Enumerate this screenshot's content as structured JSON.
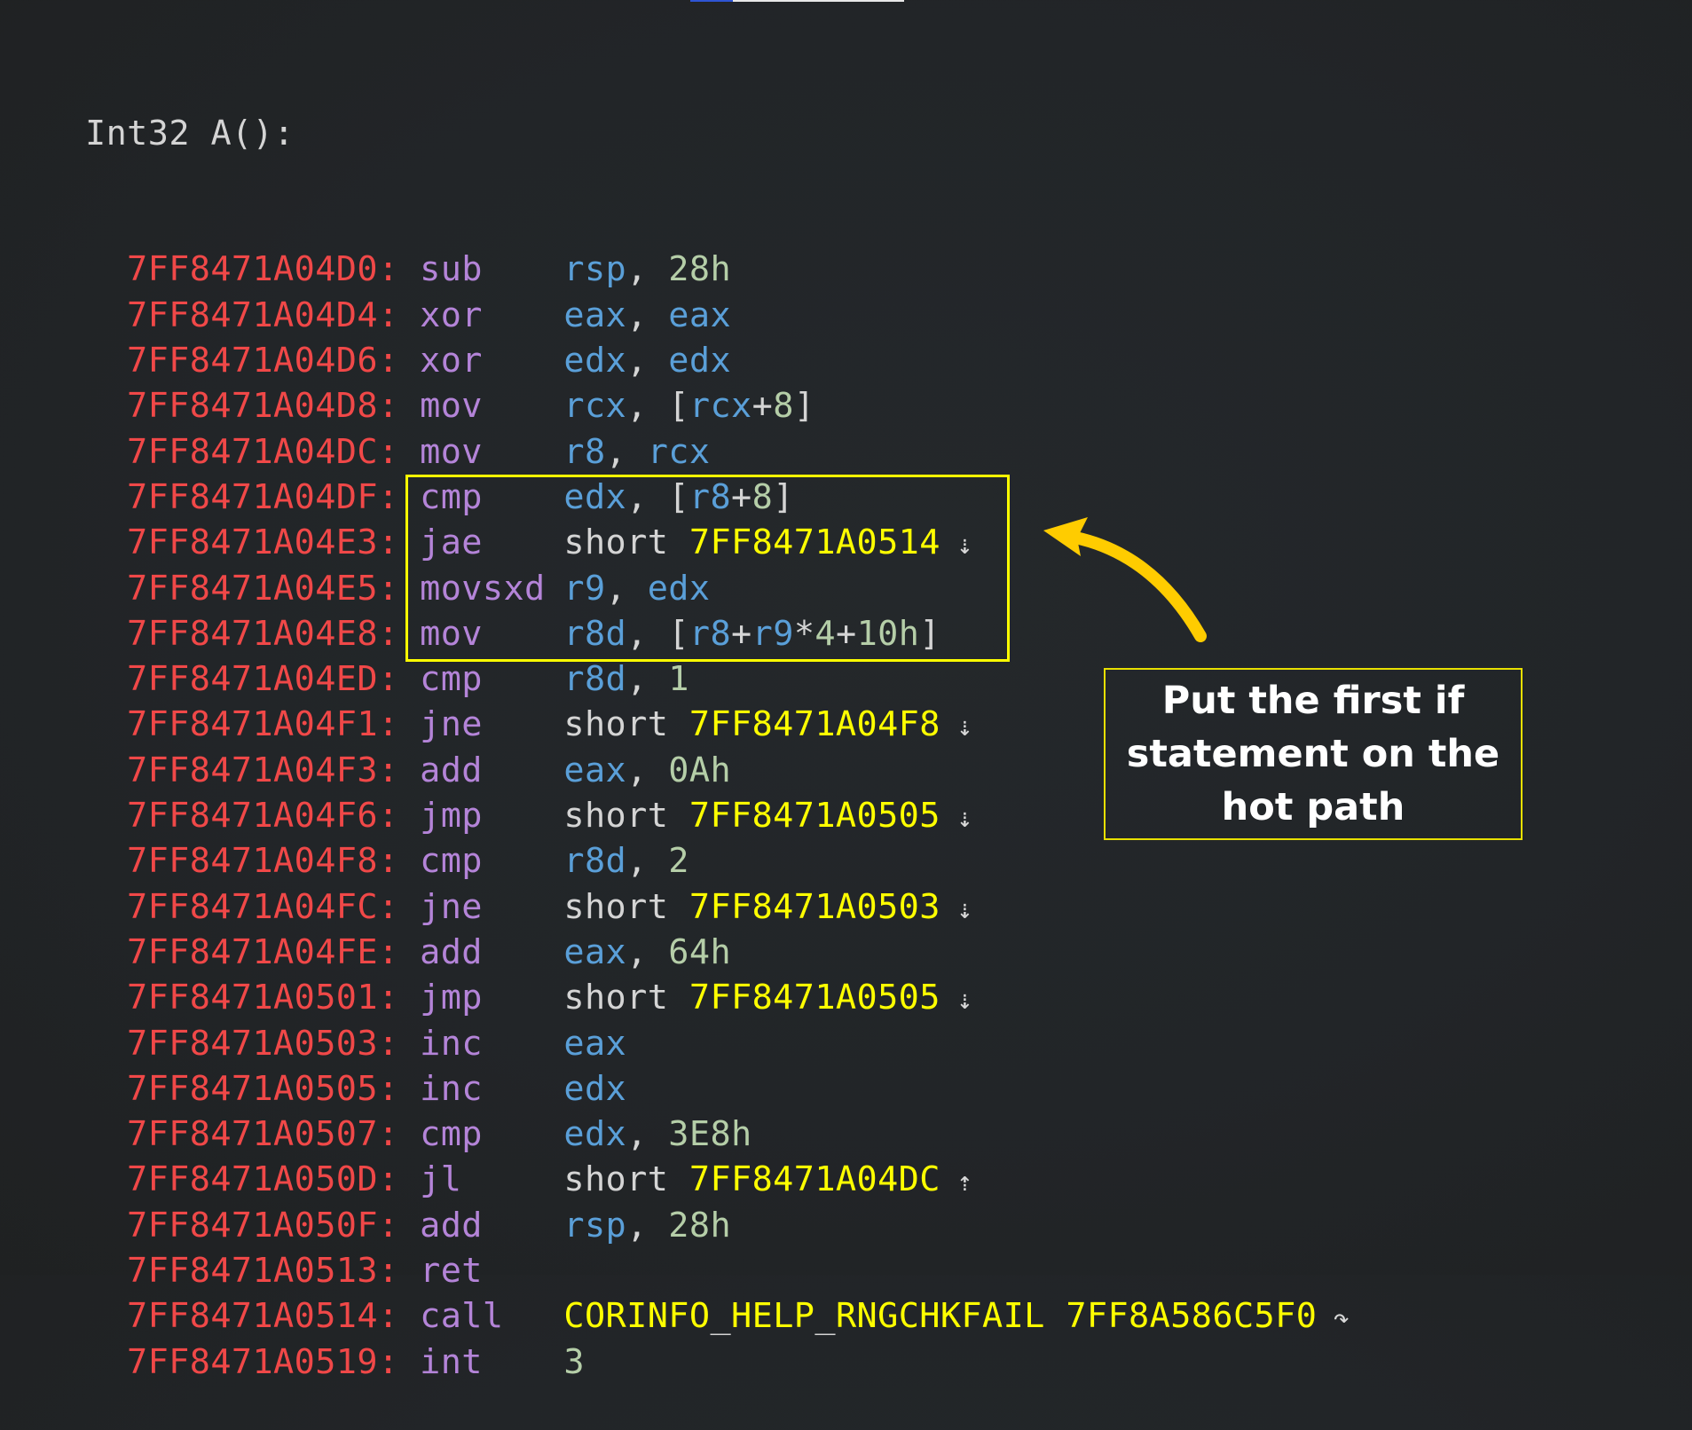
{
  "progress": {
    "value_percent": 20,
    "color": "#2f55d4"
  },
  "function_header": "Int32 A():",
  "colors": {
    "address": "#f04848",
    "mnemonic": "#b484d8",
    "register": "#5a9fd8",
    "number": "#b5cea8",
    "label": "#ffff00",
    "text": "#d4d4d4",
    "highlight": "#ffff00",
    "arrow": "#ffcc00"
  },
  "instructions": [
    {
      "addr": "7FF8471A04D0:",
      "mn": "sub",
      "ops": [
        [
          "reg",
          "rsp"
        ],
        [
          "punc",
          ", "
        ],
        [
          "num",
          "28h"
        ]
      ]
    },
    {
      "addr": "7FF8471A04D4:",
      "mn": "xor",
      "ops": [
        [
          "reg",
          "eax"
        ],
        [
          "punc",
          ", "
        ],
        [
          "reg",
          "eax"
        ]
      ]
    },
    {
      "addr": "7FF8471A04D6:",
      "mn": "xor",
      "ops": [
        [
          "reg",
          "edx"
        ],
        [
          "punc",
          ", "
        ],
        [
          "reg",
          "edx"
        ]
      ]
    },
    {
      "addr": "7FF8471A04D8:",
      "mn": "mov",
      "ops": [
        [
          "reg",
          "rcx"
        ],
        [
          "punc",
          ", ["
        ],
        [
          "reg",
          "rcx"
        ],
        [
          "punc",
          "+"
        ],
        [
          "num",
          "8"
        ],
        [
          "punc",
          "]"
        ]
      ]
    },
    {
      "addr": "7FF8471A04DC:",
      "mn": "mov",
      "ops": [
        [
          "reg",
          "r8"
        ],
        [
          "punc",
          ", "
        ],
        [
          "reg",
          "rcx"
        ]
      ]
    },
    {
      "addr": "7FF8471A04DF:",
      "mn": "cmp",
      "ops": [
        [
          "reg",
          "edx"
        ],
        [
          "punc",
          ", ["
        ],
        [
          "reg",
          "r8"
        ],
        [
          "punc",
          "+"
        ],
        [
          "num",
          "8"
        ],
        [
          "punc",
          "]"
        ]
      ]
    },
    {
      "addr": "7FF8471A04E3:",
      "mn": "jae",
      "ops": [
        [
          "kw",
          "short "
        ],
        [
          "lbl",
          "7FF8471A0514"
        ],
        [
          "glyph",
          " ⇣"
        ]
      ]
    },
    {
      "addr": "7FF8471A04E5:",
      "mn": "movsxd",
      "ops": [
        [
          "reg",
          "r9"
        ],
        [
          "punc",
          ", "
        ],
        [
          "reg",
          "edx"
        ]
      ]
    },
    {
      "addr": "7FF8471A04E8:",
      "mn": "mov",
      "ops": [
        [
          "reg",
          "r8d"
        ],
        [
          "punc",
          ", ["
        ],
        [
          "reg",
          "r8"
        ],
        [
          "punc",
          "+"
        ],
        [
          "reg",
          "r9"
        ],
        [
          "punc",
          "*"
        ],
        [
          "num",
          "4"
        ],
        [
          "punc",
          "+"
        ],
        [
          "num",
          "10h"
        ],
        [
          "punc",
          "]"
        ]
      ]
    },
    {
      "addr": "7FF8471A04ED:",
      "mn": "cmp",
      "ops": [
        [
          "reg",
          "r8d"
        ],
        [
          "punc",
          ", "
        ],
        [
          "num",
          "1"
        ]
      ]
    },
    {
      "addr": "7FF8471A04F1:",
      "mn": "jne",
      "ops": [
        [
          "kw",
          "short "
        ],
        [
          "lbl",
          "7FF8471A04F8"
        ],
        [
          "glyph",
          " ⇣"
        ]
      ]
    },
    {
      "addr": "7FF8471A04F3:",
      "mn": "add",
      "ops": [
        [
          "reg",
          "eax"
        ],
        [
          "punc",
          ", "
        ],
        [
          "num",
          "0Ah"
        ]
      ]
    },
    {
      "addr": "7FF8471A04F6:",
      "mn": "jmp",
      "ops": [
        [
          "kw",
          "short "
        ],
        [
          "lbl",
          "7FF8471A0505"
        ],
        [
          "glyph",
          " ⇣"
        ]
      ]
    },
    {
      "addr": "7FF8471A04F8:",
      "mn": "cmp",
      "ops": [
        [
          "reg",
          "r8d"
        ],
        [
          "punc",
          ", "
        ],
        [
          "num",
          "2"
        ]
      ]
    },
    {
      "addr": "7FF8471A04FC:",
      "mn": "jne",
      "ops": [
        [
          "kw",
          "short "
        ],
        [
          "lbl",
          "7FF8471A0503"
        ],
        [
          "glyph",
          " ⇣"
        ]
      ]
    },
    {
      "addr": "7FF8471A04FE:",
      "mn": "add",
      "ops": [
        [
          "reg",
          "eax"
        ],
        [
          "punc",
          ", "
        ],
        [
          "num",
          "64h"
        ]
      ]
    },
    {
      "addr": "7FF8471A0501:",
      "mn": "jmp",
      "ops": [
        [
          "kw",
          "short "
        ],
        [
          "lbl",
          "7FF8471A0505"
        ],
        [
          "glyph",
          " ⇣"
        ]
      ]
    },
    {
      "addr": "7FF8471A0503:",
      "mn": "inc",
      "ops": [
        [
          "reg",
          "eax"
        ]
      ]
    },
    {
      "addr": "7FF8471A0505:",
      "mn": "inc",
      "ops": [
        [
          "reg",
          "edx"
        ]
      ]
    },
    {
      "addr": "7FF8471A0507:",
      "mn": "cmp",
      "ops": [
        [
          "reg",
          "edx"
        ],
        [
          "punc",
          ", "
        ],
        [
          "num",
          "3E8h"
        ]
      ]
    },
    {
      "addr": "7FF8471A050D:",
      "mn": "jl",
      "ops": [
        [
          "kw",
          "short "
        ],
        [
          "lbl",
          "7FF8471A04DC"
        ],
        [
          "glyph",
          " ⇡"
        ]
      ]
    },
    {
      "addr": "7FF8471A050F:",
      "mn": "add",
      "ops": [
        [
          "reg",
          "rsp"
        ],
        [
          "punc",
          ", "
        ],
        [
          "num",
          "28h"
        ]
      ]
    },
    {
      "addr": "7FF8471A0513:",
      "mn": "ret",
      "ops": []
    },
    {
      "addr": "7FF8471A0514:",
      "mn": "call",
      "ops": [
        [
          "lbl",
          "CORINFO"
        ],
        [
          "punc",
          "_"
        ],
        [
          "lbl",
          "HELP"
        ],
        [
          "punc",
          "_"
        ],
        [
          "lbl",
          "RNGCHKFAIL 7FF8A586C5F0"
        ],
        [
          "glyph",
          " ↷"
        ]
      ]
    },
    {
      "addr": "7FF8471A0519:",
      "mn": "int",
      "ops": [
        [
          "num",
          "3"
        ]
      ]
    }
  ],
  "highlighted_range": [
    "7FF8471A04ED:",
    "7FF8471A04F3:"
  ],
  "annotation": {
    "text": "Put the first if statement on the hot path"
  }
}
